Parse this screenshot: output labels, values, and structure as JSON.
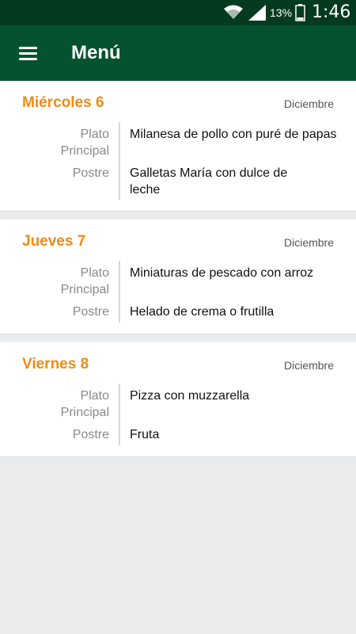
{
  "status_bar": {
    "battery": "13%",
    "time": "1:46",
    "icons": [
      "wifi-icon",
      "signal-icon",
      "battery-icon"
    ]
  },
  "app_bar": {
    "title": "Menú",
    "menu_icon": "hamburger-menu-icon"
  },
  "colors": {
    "status_bar": "#033a20",
    "app_bar": "#05532e",
    "day_accent": "#f08a16",
    "background": "#e9ebed"
  },
  "days": [
    {
      "day": "Miércoles 6",
      "month": "Diciembre",
      "main_label": "Plato Principal",
      "main_dish": "Milanesa de pollo con puré de papas",
      "dessert_label": "Postre",
      "dessert": "Galletas María con dulce de leche"
    },
    {
      "day": "Jueves 7",
      "month": "Diciembre",
      "main_label": "Plato Principal",
      "main_dish": "Miniaturas de pescado con arroz",
      "dessert_label": "Postre",
      "dessert": "Helado de crema o frutilla"
    },
    {
      "day": "Viernes 8",
      "month": "Diciembre",
      "main_label": "Plato Principal",
      "main_dish": "Pizza con muzzarella",
      "dessert_label": "Postre",
      "dessert": "Fruta"
    }
  ]
}
